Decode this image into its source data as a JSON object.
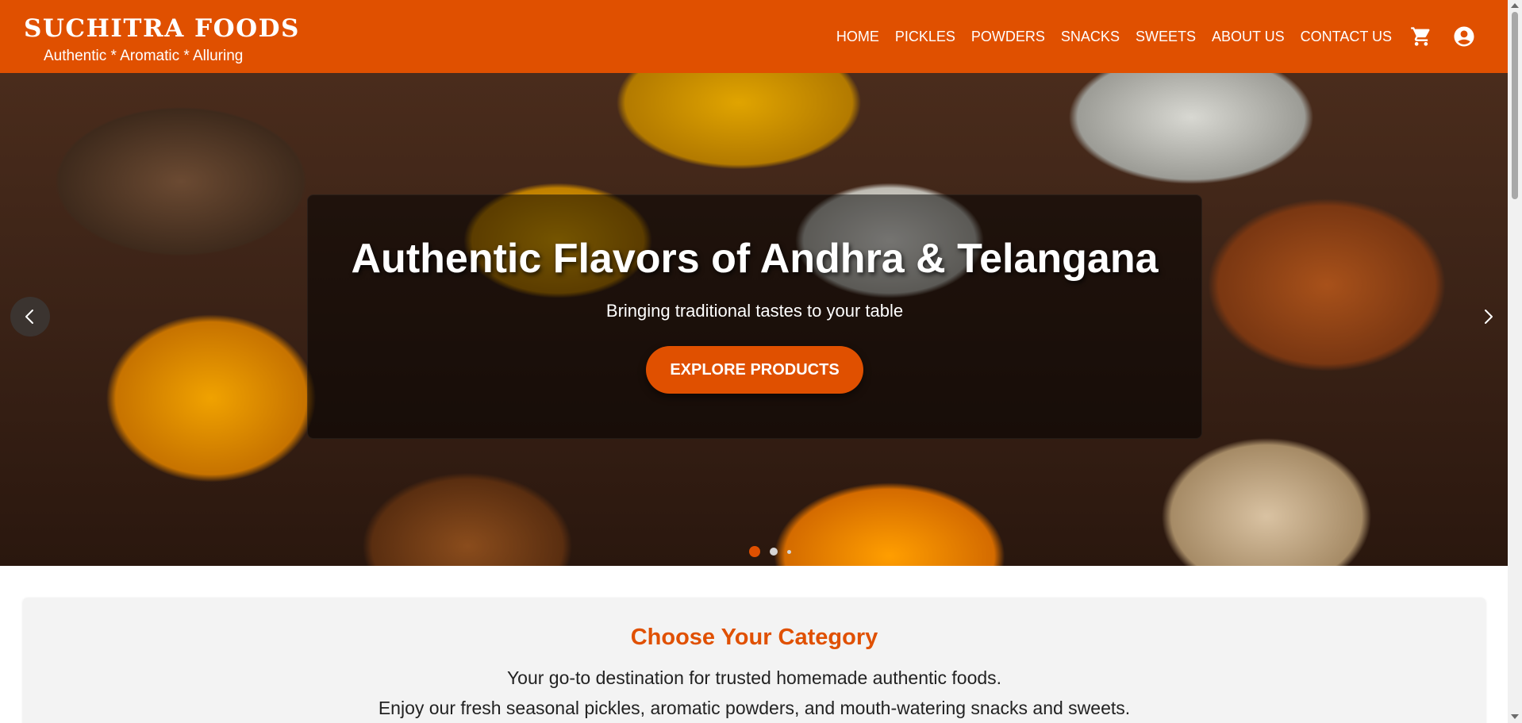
{
  "header": {
    "brand_name": "SUCHITRA FOODS",
    "tagline": "Authentic * Aromatic * Alluring",
    "nav": [
      {
        "label": "HOME"
      },
      {
        "label": "PICKLES"
      },
      {
        "label": "POWDERS"
      },
      {
        "label": "SNACKS"
      },
      {
        "label": "SWEETS"
      },
      {
        "label": "ABOUT US"
      },
      {
        "label": "CONTACT US"
      }
    ],
    "cart_icon": "shopping-cart-icon",
    "account_icon": "account-circle-icon",
    "background_color": "#e05000"
  },
  "hero": {
    "title": "Authentic Flavors of Andhra & Telangana",
    "subtitle": "Bringing traditional tastes to your table",
    "cta_label": "EXPLORE PRODUCTS",
    "prev_icon": "chevron-left-icon",
    "next_icon": "chevron-right-icon",
    "slides_count": 3,
    "active_slide": 1
  },
  "category": {
    "title": "Choose Your Category",
    "line1": "Your go-to destination for trusted homemade authentic foods.",
    "line2": "Enjoy our fresh seasonal pickles, aromatic powders, and mouth-watering snacks and sweets."
  },
  "colors": {
    "accent": "#e05000",
    "section_bg": "#f3f3f3"
  }
}
